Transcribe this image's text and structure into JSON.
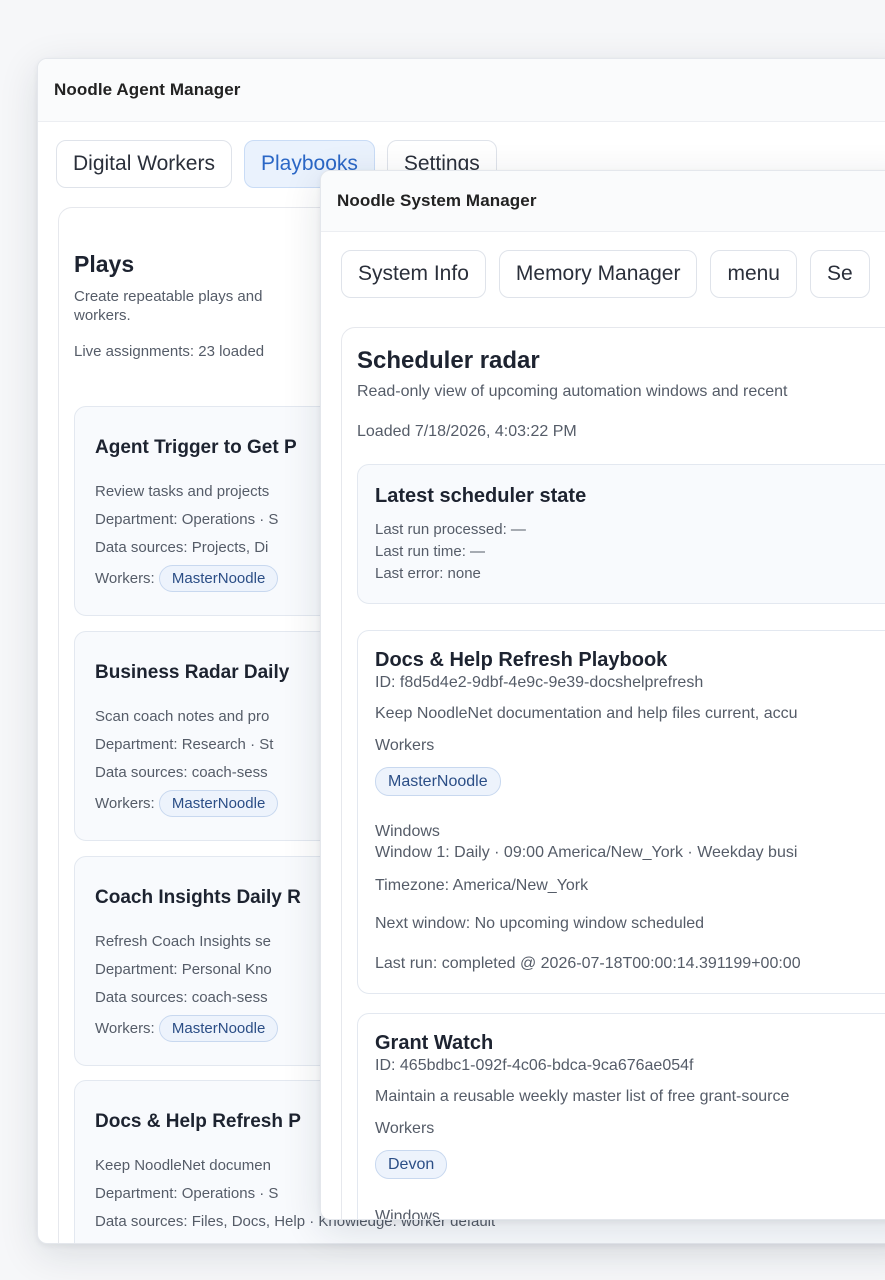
{
  "agent_window": {
    "title": "Noodle Agent Manager",
    "tabs": [
      {
        "label": "Digital Workers"
      },
      {
        "label": "Playbooks"
      },
      {
        "label": "Settings"
      }
    ],
    "active_tab": "Playbooks",
    "plays": {
      "heading": "Plays",
      "description": "Create repeatable plays and … workers.",
      "description_line1": "Create repeatable plays and",
      "description_line2": "workers.",
      "live": "Live assignments: 23 loaded",
      "workers_label": "Workers:",
      "cards": [
        {
          "title": "Agent Trigger to Get P",
          "line1": "Review tasks and projects",
          "line2": "Department: Operations · S",
          "line3": "Data sources: Projects, Di",
          "worker": "MasterNoodle"
        },
        {
          "title": "Business Radar Daily",
          "line1": "Scan coach notes and pro",
          "line2": "Department: Research · St",
          "line3": "Data sources: coach-sess",
          "worker": "MasterNoodle"
        },
        {
          "title": "Coach Insights Daily R",
          "line1": "Refresh Coach Insights se",
          "line2": "Department: Personal Kno",
          "line3": "Data sources: coach-sess",
          "worker": "MasterNoodle"
        },
        {
          "title": "Docs & Help Refresh P",
          "line1": "Keep NoodleNet documen",
          "line2": "Department: Operations · S",
          "line3": "Data sources: Files, Docs, Help · Knowledge: worker default",
          "worker": ""
        }
      ]
    }
  },
  "system_window": {
    "title": "Noodle System Manager",
    "tabs": [
      {
        "label": "System Info"
      },
      {
        "label": "Memory Manager"
      },
      {
        "label": "menu"
      },
      {
        "label": "Se"
      }
    ],
    "radar": {
      "heading": "Scheduler radar",
      "subtitle": "Read-only view of upcoming automation windows and recent",
      "loaded": "Loaded 7/18/2026, 4:03:22 PM",
      "state": {
        "heading": "Latest scheduler state",
        "processed": "Last run processed: —",
        "time": "Last run time: —",
        "error": "Last error: none"
      },
      "playbooks": [
        {
          "title": "Docs & Help Refresh Playbook",
          "id": "ID: f8d5d4e2-9dbf-4e9c-9e39-docshelprefresh",
          "desc": "Keep NoodleNet documentation and help files current, accu",
          "workers_label": "Workers",
          "worker": "MasterNoodle",
          "windows_label": "Windows",
          "window1": "Window 1: Daily · 09:00 America/New_York · Weekday busi",
          "timezone": "Timezone: America/New_York",
          "next": "Next window: No upcoming window scheduled",
          "last": "Last run: completed @ 2026-07-18T00:00:14.391199+00:00"
        },
        {
          "title": "Grant Watch",
          "id": "ID: 465bdbc1-092f-4c06-bdca-9ca676ae054f",
          "desc": "Maintain a reusable weekly master list of free grant-source",
          "workers_label": "Workers",
          "worker": "Devon",
          "windows_label": "Windows"
        }
      ]
    }
  }
}
